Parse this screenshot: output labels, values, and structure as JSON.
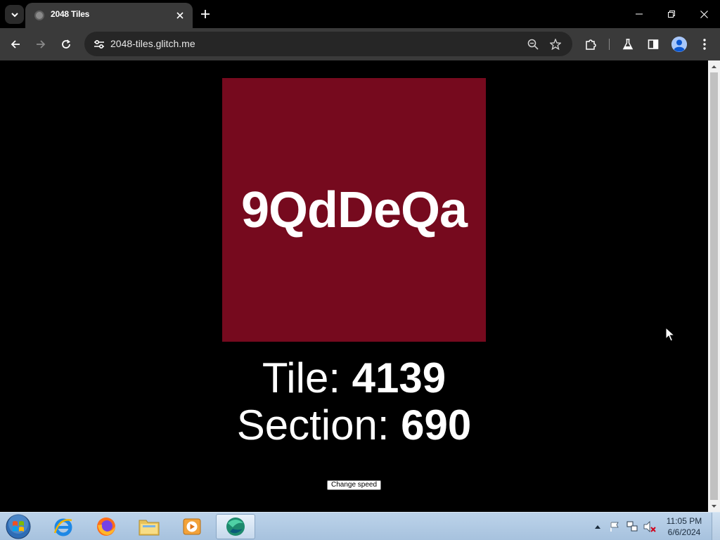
{
  "browser": {
    "tab_title": "2048 Tiles",
    "url": "2048-tiles.glitch.me",
    "icons": {
      "tab_search": "chevron-down-icon",
      "tab_favicon": "globe-icon",
      "tab_close": "close-icon",
      "new_tab": "plus-icon",
      "minimize": "minimize-icon",
      "restore": "restore-icon",
      "close_window": "close-icon",
      "back": "arrow-left-icon",
      "forward": "arrow-right-icon",
      "reload": "reload-icon",
      "site_info": "tune-icon",
      "zoom": "zoom-icon",
      "bookmark": "star-icon",
      "extensions": "puzzle-icon",
      "labs": "flask-icon",
      "side_panel": "side-panel-icon",
      "profile": "avatar-icon",
      "menu": "kebab-menu-icon"
    }
  },
  "page": {
    "tile_text": "9QdDeQa",
    "tile_color": "#760a1e",
    "tile_label": "Tile: ",
    "tile_value": "4139",
    "section_label": "Section: ",
    "section_value": "690",
    "button_label": "Change speed"
  },
  "taskbar": {
    "apps": [
      "internet-explorer-icon",
      "firefox-icon",
      "file-explorer-icon",
      "media-player-icon",
      "browser-app-icon"
    ],
    "clock_time": "11:05 PM",
    "clock_date": "6/6/2024",
    "tray_icons": [
      "show-hidden-icons",
      "action-center-flag-icon",
      "network-icon",
      "volume-muted-icon"
    ]
  }
}
